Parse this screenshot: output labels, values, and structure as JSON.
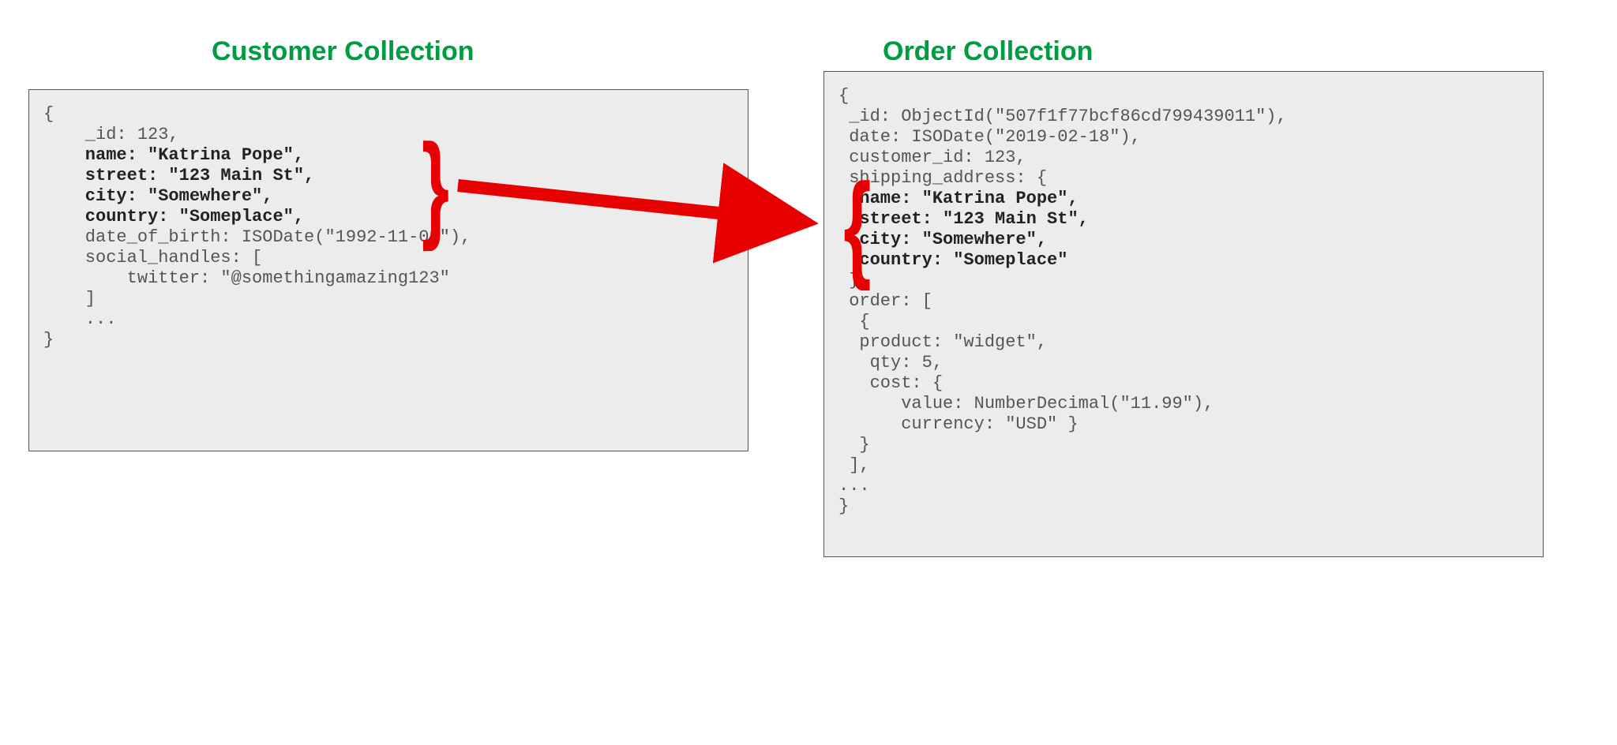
{
  "left": {
    "title": "Customer Collection",
    "code": {
      "open": "{",
      "id": "    _id: 123,",
      "name": "    name: \"Katrina Pope\",",
      "street": "    street: \"123 Main St\",",
      "city": "    city: \"Somewhere\",",
      "country": "    country: \"Someplace\",",
      "dob": "    date_of_birth: ISODate(\"1992-11-03\"),",
      "social_open": "    social_handles: [",
      "twitter": "        twitter: \"@somethingamazing123\"",
      "social_close": "    ]",
      "dots": "    ...",
      "close": "}"
    }
  },
  "right": {
    "title": "Order Collection",
    "code": {
      "open": "{",
      "id": " _id: ObjectId(\"507f1f77bcf86cd799439011\"),",
      "date": " date: ISODate(\"2019-02-18\"),",
      "customer_id": " customer_id: 123,",
      "ship_open": " shipping_address: {",
      "name": "  name: \"Katrina Pope\",",
      "street": "  street: \"123 Main St\",",
      "city": "  city: \"Somewhere\",",
      "country": "  country: \"Someplace\"",
      "ship_close": " },",
      "order_open": " order: [",
      "item_open": "  {",
      "product": "  product: \"widget\",",
      "qty": "   qty: 5,",
      "cost_open": "   cost: {",
      "value": "      value: NumberDecimal(\"11.99\"),",
      "currency": "      currency: \"USD\" }",
      "item_close": "  }",
      "order_close": " ],",
      "dots": "...",
      "close": "}"
    }
  }
}
